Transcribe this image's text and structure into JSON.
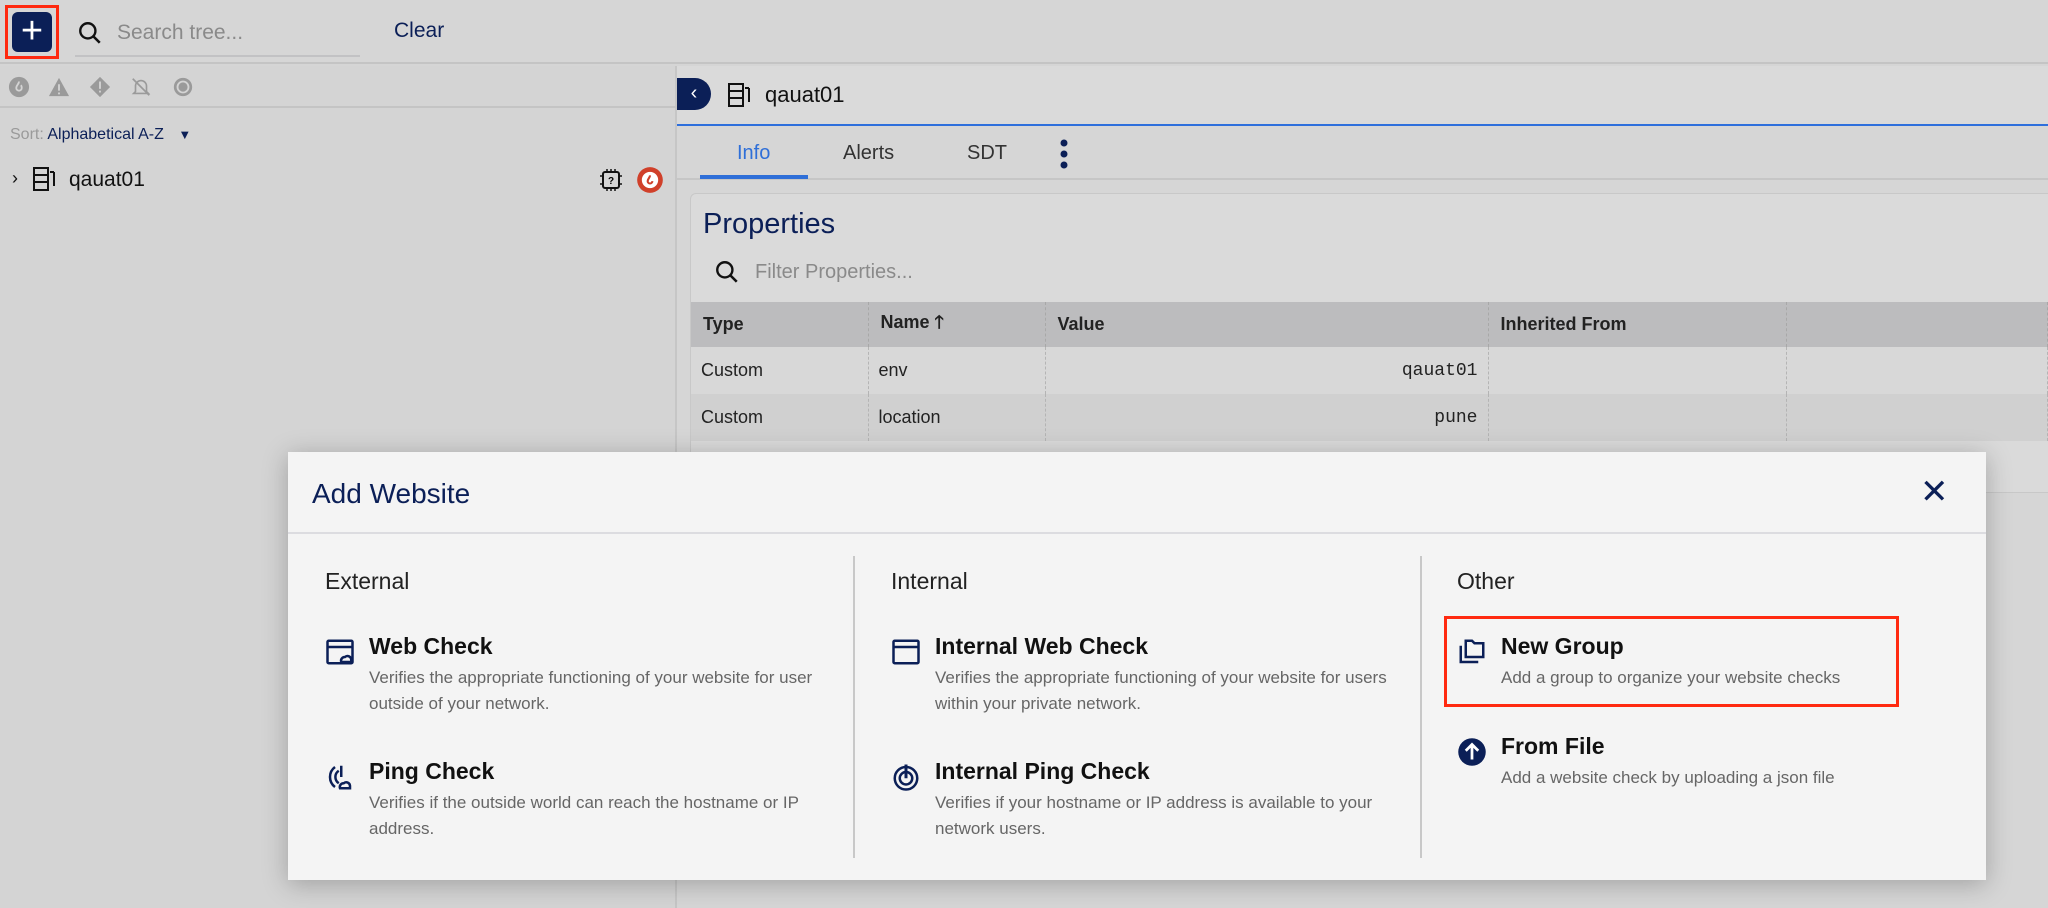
{
  "topbar": {
    "add_label": "+",
    "search_placeholder": "Search tree...",
    "clear_label": "Clear"
  },
  "tree": {
    "sort_label": "Sort:",
    "sort_value": "Alphabetical A-Z",
    "items": [
      {
        "label": "qauat01"
      }
    ]
  },
  "detail": {
    "title": "qauat01",
    "tabs": [
      "Info",
      "Alerts",
      "SDT"
    ],
    "active_tab": "Info"
  },
  "properties": {
    "title": "Properties",
    "filter_placeholder": "Filter Properties...",
    "columns": [
      "Type",
      "Name",
      "Value",
      "Inherited From"
    ],
    "rows": [
      {
        "type": "Custom",
        "name": "env",
        "value": "qauat01",
        "inherited": ""
      },
      {
        "type": "Custom",
        "name": "location",
        "value": "pune",
        "inherited": ""
      }
    ]
  },
  "modal": {
    "title": "Add Website",
    "close": "✕",
    "sections": [
      {
        "heading": "External",
        "items": [
          {
            "title": "Web Check",
            "desc": "Verifies the appropriate functioning of your website for user outside of your network."
          },
          {
            "title": "Ping Check",
            "desc": "Verifies if the outside world can reach the hostname or IP address."
          }
        ]
      },
      {
        "heading": "Internal",
        "items": [
          {
            "title": "Internal Web Check",
            "desc": "Verifies the appropriate functioning of your website for users within your private network."
          },
          {
            "title": "Internal Ping Check",
            "desc": "Verifies if your hostname or IP address is available to your network users."
          }
        ]
      },
      {
        "heading": "Other",
        "items": [
          {
            "title": "New Group",
            "desc": "Add a group to organize your website checks"
          },
          {
            "title": "From File",
            "desc": "Add a website check by uploading a json file"
          }
        ]
      }
    ]
  },
  "colors": {
    "navy": "#0b1f57",
    "accent": "#2f6fd8",
    "highlight": "#ff2a10",
    "alert": "#d0402a"
  }
}
